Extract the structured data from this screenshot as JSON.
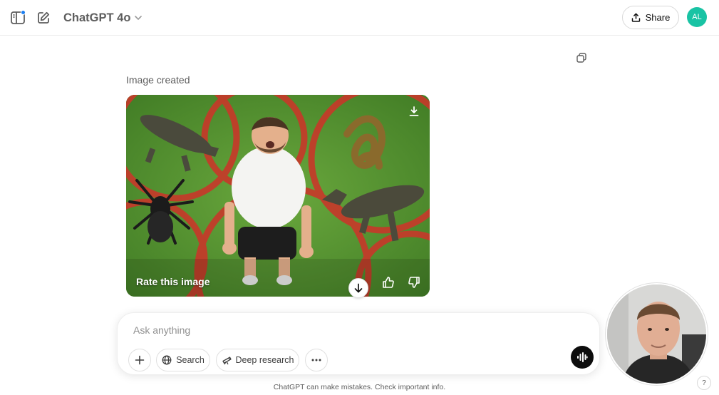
{
  "header": {
    "model_name": "ChatGPT 4o",
    "share_label": "Share",
    "avatar_initials": "AL"
  },
  "message": {
    "status": "Image created",
    "rate_label": "Rate this image"
  },
  "composer": {
    "placeholder": "Ask anything",
    "search_label": "Search",
    "deep_research_label": "Deep research"
  },
  "footer": {
    "disclaimer": "ChatGPT can make mistakes. Check important info.",
    "help_label": "?"
  },
  "colors": {
    "accent": "#1a7ef2",
    "avatar_bg": "#19c3a4",
    "voice_button": "#0d0d0d"
  },
  "icons": {
    "sidebar": "sidebar-toggle-icon",
    "new_chat": "edit-icon",
    "share": "share-upload-icon",
    "copy": "copy-icon",
    "download": "download-icon",
    "thumb_up": "thumb-up-icon",
    "thumb_down": "thumb-down-icon",
    "scroll_down": "arrow-down-icon",
    "plus": "plus-icon",
    "search": "globe-icon",
    "deep_research": "telescope-icon",
    "more": "more-horizontal-icon",
    "voice": "voice-waveform-icon"
  }
}
